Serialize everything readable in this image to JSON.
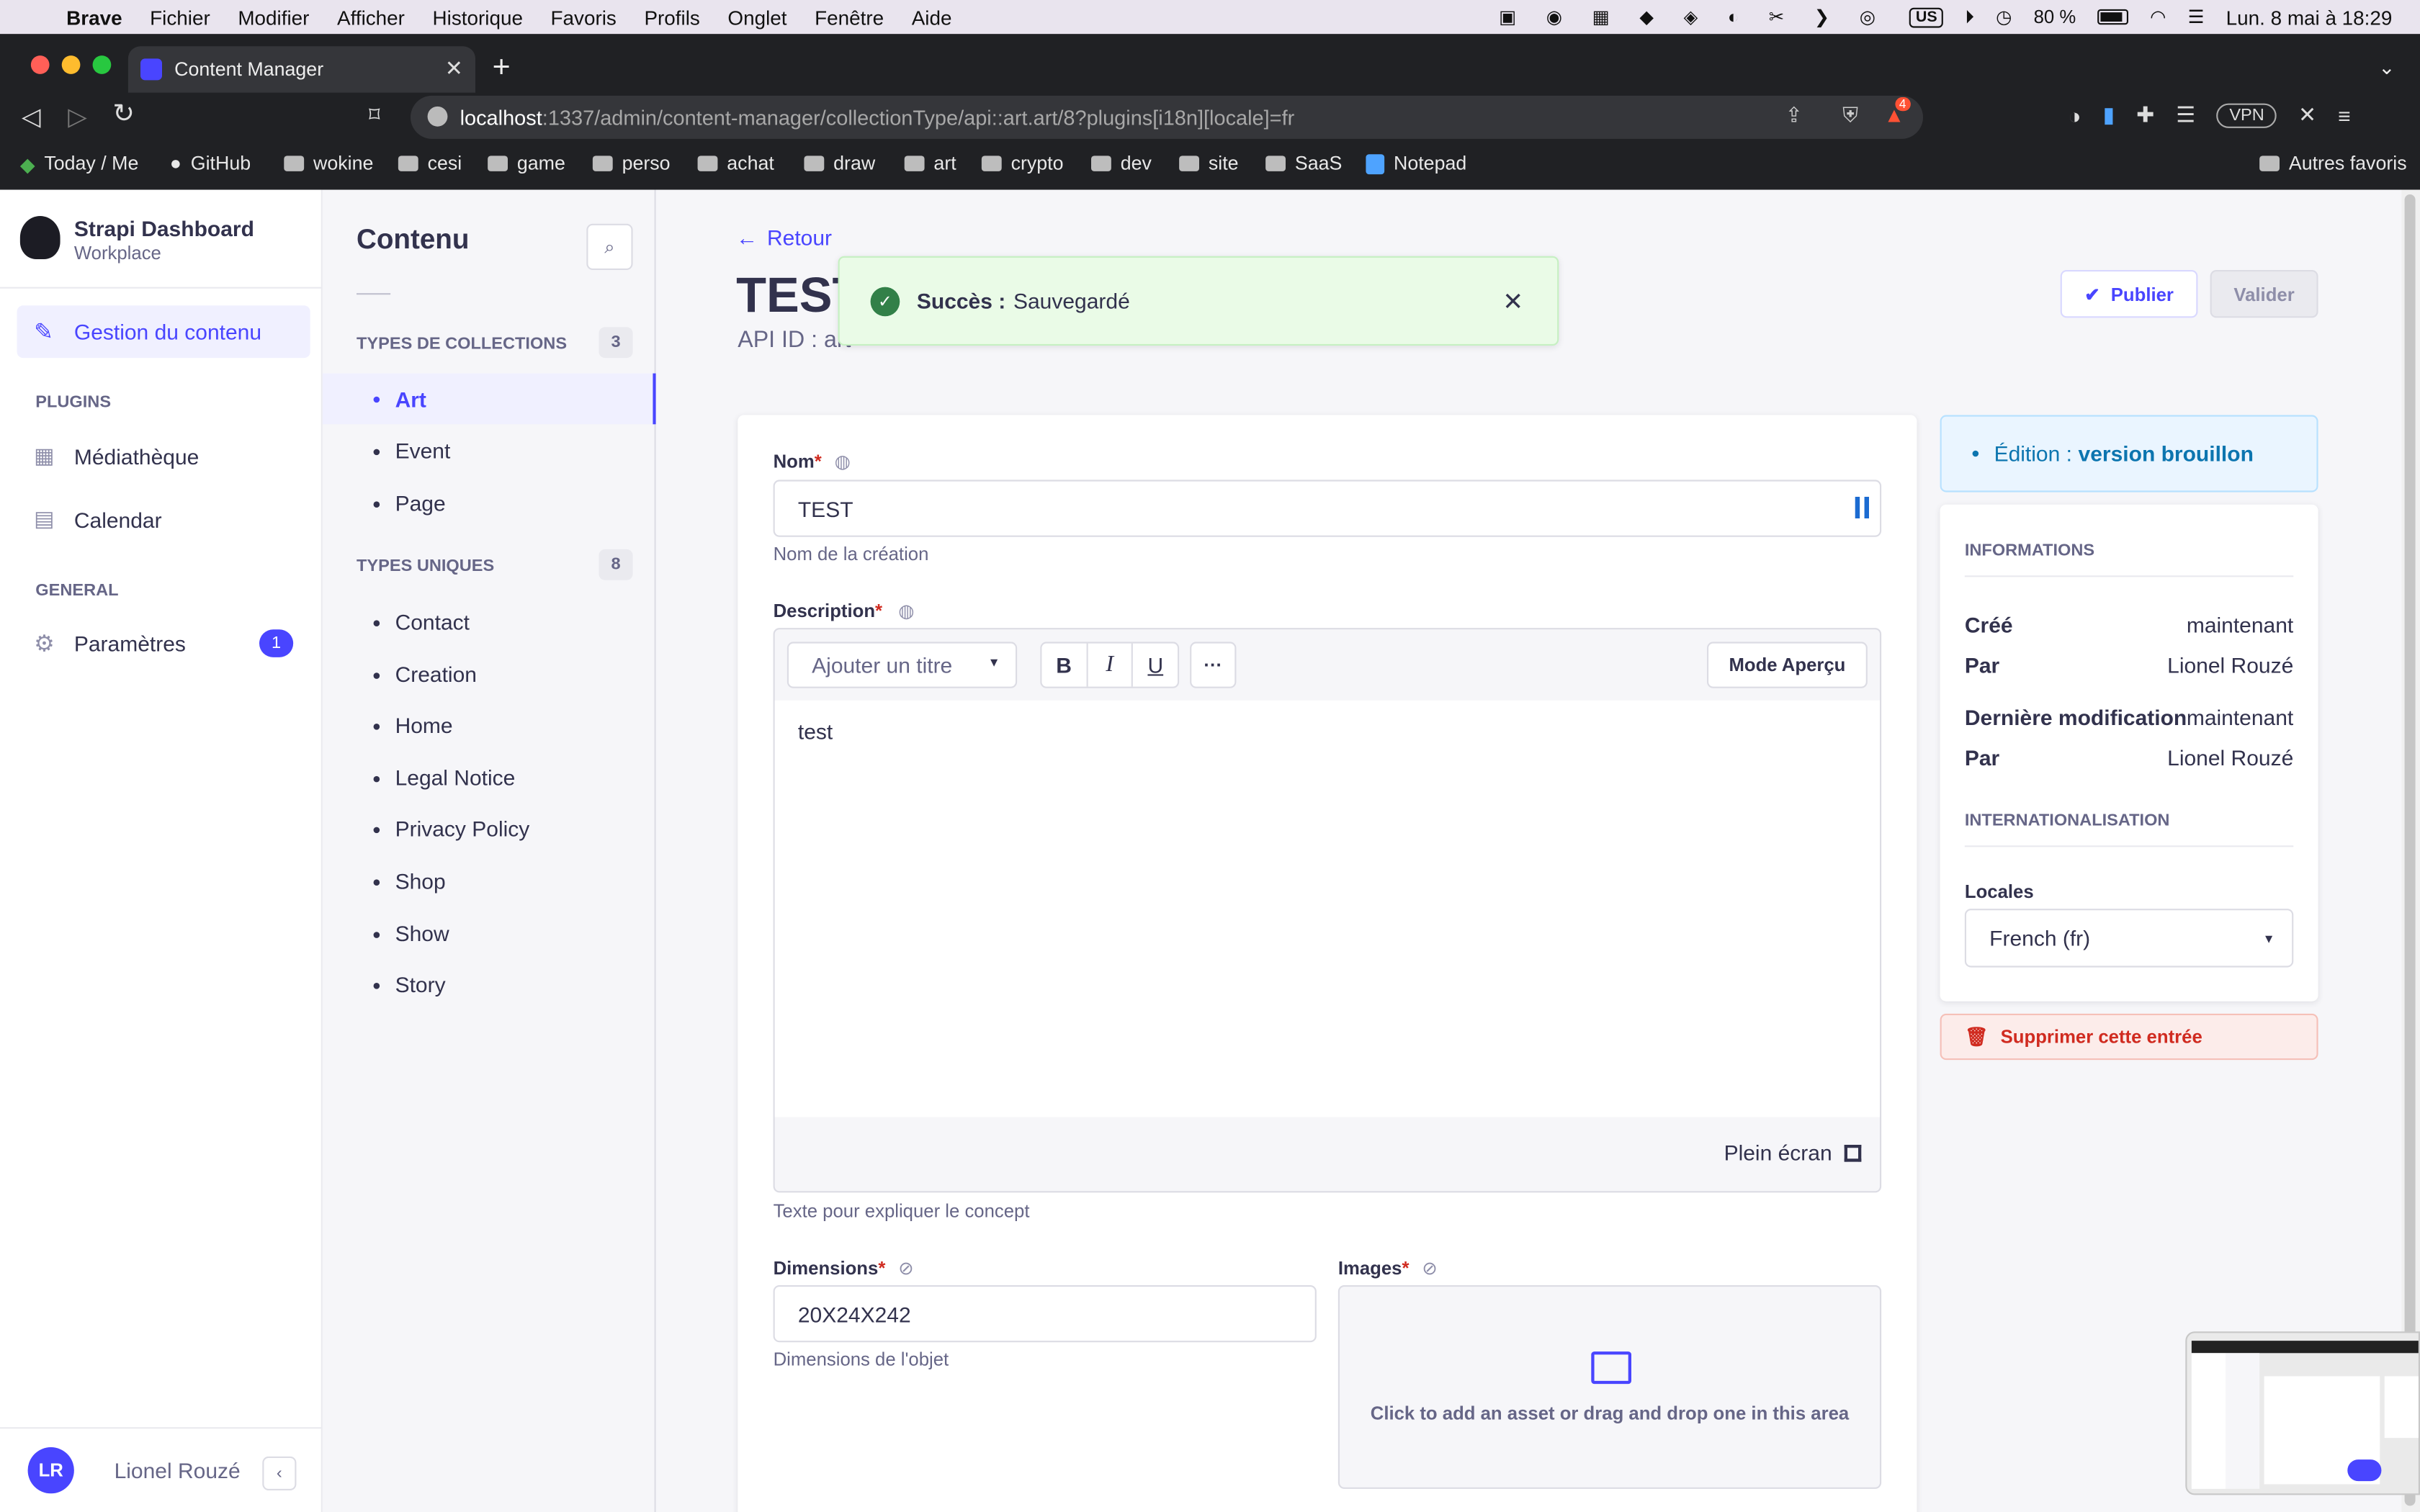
{
  "os_menubar": {
    "apple_icon": "apple-icon",
    "app_name": "Brave",
    "items": [
      "Fichier",
      "Modifier",
      "Afficher",
      "Historique",
      "Favoris",
      "Profils",
      "Onglet",
      "Fenêtre",
      "Aide"
    ],
    "keyboard_layout": "US",
    "battery": "80 %",
    "datetime": "Lun. 8 mai à 18:29"
  },
  "browser": {
    "tab_title": "Content Manager",
    "url_host": "localhost",
    "url_rest": ":1337/admin/content-manager/collectionType/api::art.art/8?plugins[i18n][locale]=fr",
    "brave_badge": "4",
    "vpn_label": "VPN",
    "bookmarks": [
      "Today / Me",
      "GitHub",
      "wokine",
      "cesi",
      "game",
      "perso",
      "achat",
      "draw",
      "art",
      "crypto",
      "dev",
      "site",
      "SaaS",
      "Notepad"
    ],
    "other_bookmarks": "Autres favoris"
  },
  "sidebar": {
    "brand_title": "Strapi Dashboard",
    "brand_subtitle": "Workplace",
    "content_manager": "Gestion du contenu",
    "plugins_heading": "PLUGINS",
    "media_library": "Médiathèque",
    "calendar": "Calendar",
    "general_heading": "GENERAL",
    "settings": "Paramètres",
    "settings_badge": "1",
    "user_initials": "LR",
    "user_name": "Lionel Rouzé"
  },
  "content_nav": {
    "title": "Contenu",
    "collection_heading": "TYPES DE COLLECTIONS",
    "collection_count": "3",
    "collections": [
      "Art",
      "Event",
      "Page"
    ],
    "single_heading": "TYPES UNIQUES",
    "single_count": "8",
    "singles": [
      "Contact",
      "Creation",
      "Home",
      "Legal Notice",
      "Privacy Policy",
      "Shop",
      "Show",
      "Story"
    ]
  },
  "header": {
    "back": "Retour",
    "title": "TEST",
    "api_id": "API ID : art",
    "publish": "Publier",
    "save": "Valider"
  },
  "toast": {
    "strong": "Succès :",
    "message": "Sauvegardé"
  },
  "form": {
    "nom_label": "Nom",
    "nom_value": "TEST",
    "nom_hint": "Nom de la création",
    "desc_label": "Description",
    "heading_select": "Ajouter un titre",
    "bold": "B",
    "italic": "I",
    "underline": "U",
    "more": "···",
    "preview_mode": "Mode Aperçu",
    "desc_text": "test",
    "fullscreen": "Plein écran",
    "desc_hint": "Texte pour expliquer le concept",
    "dimensions_label": "Dimensions",
    "dimensions_value": "20X24X242",
    "dimensions_hint": "Dimensions de l'objet",
    "images_label": "Images",
    "images_placeholder": "Click to add an asset or drag and drop one in this area",
    "required_mark": "*"
  },
  "panel": {
    "edition_prefix": "Édition :",
    "edition_value": "version brouillon",
    "info_heading": "INFORMATIONS",
    "created_label": "Créé",
    "created_value": "maintenant",
    "by_label": "Par",
    "by_value": "Lionel Rouzé",
    "modified_label": "Dernière modification",
    "modified_value": "maintenant",
    "by2_label": "Par",
    "by2_value": "Lionel Rouzé",
    "i18n_heading": "INTERNATIONALISATION",
    "locales_label": "Locales",
    "locale_value": "French (fr)",
    "delete": "Supprimer cette entrée"
  },
  "colors": {
    "primary": "#4945ff",
    "success_bg": "#eafbe7",
    "success_border": "#c6f0c2",
    "success_icon": "#328048",
    "danger": "#d02b20",
    "danger_bg": "#fcecea"
  }
}
